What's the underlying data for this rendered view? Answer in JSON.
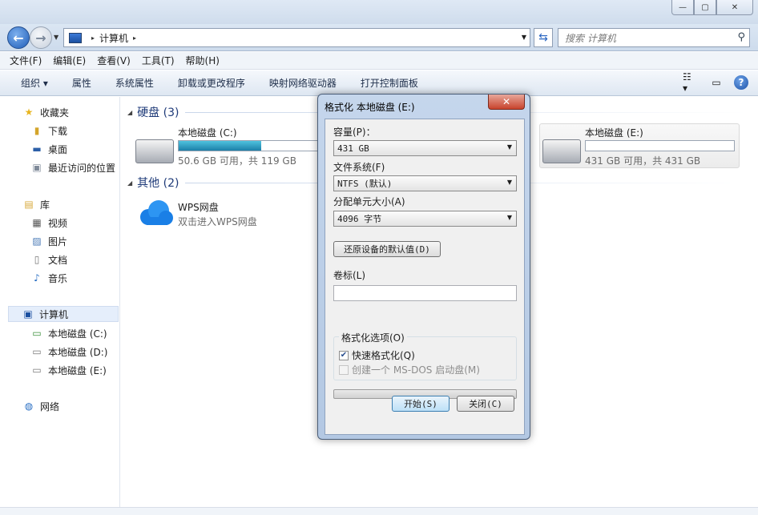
{
  "window": {
    "controls": {
      "minimize": "—",
      "maximize": "▢",
      "close": "✕"
    }
  },
  "address": {
    "path_root_sep": "▸",
    "path": "计算机",
    "path_sep": "▸",
    "search_placeholder": "搜索 计算机"
  },
  "menu": [
    "文件(F)",
    "编辑(E)",
    "查看(V)",
    "工具(T)",
    "帮助(H)"
  ],
  "toolbar": [
    "组织 ▾",
    "属性",
    "系统属性",
    "卸载或更改程序",
    "映射网络驱动器",
    "打开控制面板"
  ],
  "sidebar": {
    "favorites": "收藏夹",
    "downloads": "下载",
    "desktop": "桌面",
    "recent": "最近访问的位置",
    "libraries": "库",
    "videos": "视频",
    "pictures": "图片",
    "documents": "文档",
    "music": "音乐",
    "computer": "计算机",
    "drive_c": "本地磁盘 (C:)",
    "drive_d": "本地磁盘 (D:)",
    "drive_e": "本地磁盘 (E:)",
    "network": "网络"
  },
  "content": {
    "hard_disks_group": "硬盘 (3)",
    "other_group": "其他 (2)",
    "drive_c": {
      "name": "本地磁盘 (C:)",
      "info": "50.6 GB 可用，共 119 GB",
      "used_fraction": 0.58
    },
    "drive_e": {
      "name": "本地磁盘 (E:)",
      "info": "431 GB 可用，共 431 GB",
      "used_fraction": 0.0
    },
    "wps": {
      "name": "WPS网盘",
      "desc": "双击进入WPS网盘"
    }
  },
  "dialog": {
    "title": "格式化 本地磁盘 (E:)",
    "close": "✕",
    "capacity_label": "容量(P)：",
    "capacity_value": "431 GB",
    "fs_label": "文件系统(F)",
    "fs_value": "NTFS (默认)",
    "alloc_label": "分配单元大小(A)",
    "alloc_value": "4096 字节",
    "restore_btn": "还原设备的默认值(D)",
    "volume_label": "卷标(L)",
    "volume_value": "",
    "options_legend": "格式化选项(O)",
    "quick_format": "快速格式化(Q)",
    "quick_format_checked": true,
    "msdos": "创建一个 MS-DOS 启动盘(M)",
    "msdos_checked": false,
    "start_btn": "开始(S)",
    "close_btn": "关闭(C)"
  }
}
